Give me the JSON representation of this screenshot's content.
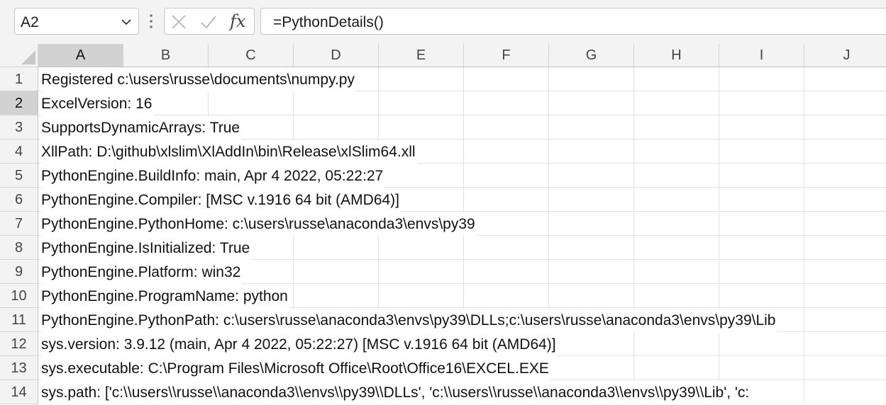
{
  "formula_bar": {
    "name_box": "A2",
    "fx_label": "fx",
    "formula": "=PythonDetails()"
  },
  "columns": [
    "A",
    "B",
    "C",
    "D",
    "E",
    "F",
    "G",
    "H",
    "I",
    "J"
  ],
  "rows": [
    {
      "num": "1",
      "text": "Registered c:\\users\\russe\\documents\\numpy.py"
    },
    {
      "num": "2",
      "text": "ExcelVersion: 16"
    },
    {
      "num": "3",
      "text": "SupportsDynamicArrays: True"
    },
    {
      "num": "4",
      "text": "XllPath: D:\\github\\xlslim\\XlAddIn\\bin\\Release\\xlSlim64.xll"
    },
    {
      "num": "5",
      "text": "PythonEngine.BuildInfo: main, Apr  4 2022, 05:22:27"
    },
    {
      "num": "6",
      "text": "PythonEngine.Compiler: [MSC v.1916 64 bit (AMD64)]"
    },
    {
      "num": "7",
      "text": "PythonEngine.PythonHome: c:\\users\\russe\\anaconda3\\envs\\py39"
    },
    {
      "num": "8",
      "text": "PythonEngine.IsInitialized: True"
    },
    {
      "num": "9",
      "text": "PythonEngine.Platform: win32"
    },
    {
      "num": "10",
      "text": "PythonEngine.ProgramName: python"
    },
    {
      "num": "11",
      "text": "PythonEngine.PythonPath: c:\\users\\russe\\anaconda3\\envs\\py39\\DLLs;c:\\users\\russe\\anaconda3\\envs\\py39\\Lib"
    },
    {
      "num": "12",
      "text": "sys.version: 3.9.12 (main, Apr  4 2022, 05:22:27) [MSC v.1916 64 bit (AMD64)]"
    },
    {
      "num": "13",
      "text": "sys.executable: C:\\Program Files\\Microsoft Office\\Root\\Office16\\EXCEL.EXE"
    },
    {
      "num": "14",
      "text": "sys.path: ['c:\\\\users\\\\russe\\\\anaconda3\\\\envs\\\\py39\\\\DLLs', 'c:\\\\users\\\\russe\\\\anaconda3\\\\envs\\\\py39\\\\Lib', 'c:"
    }
  ],
  "colors": {
    "header_bg": "#f3f3f3",
    "selected_header_bg": "#d2d2d2",
    "gridline": "#e1e1e1"
  }
}
